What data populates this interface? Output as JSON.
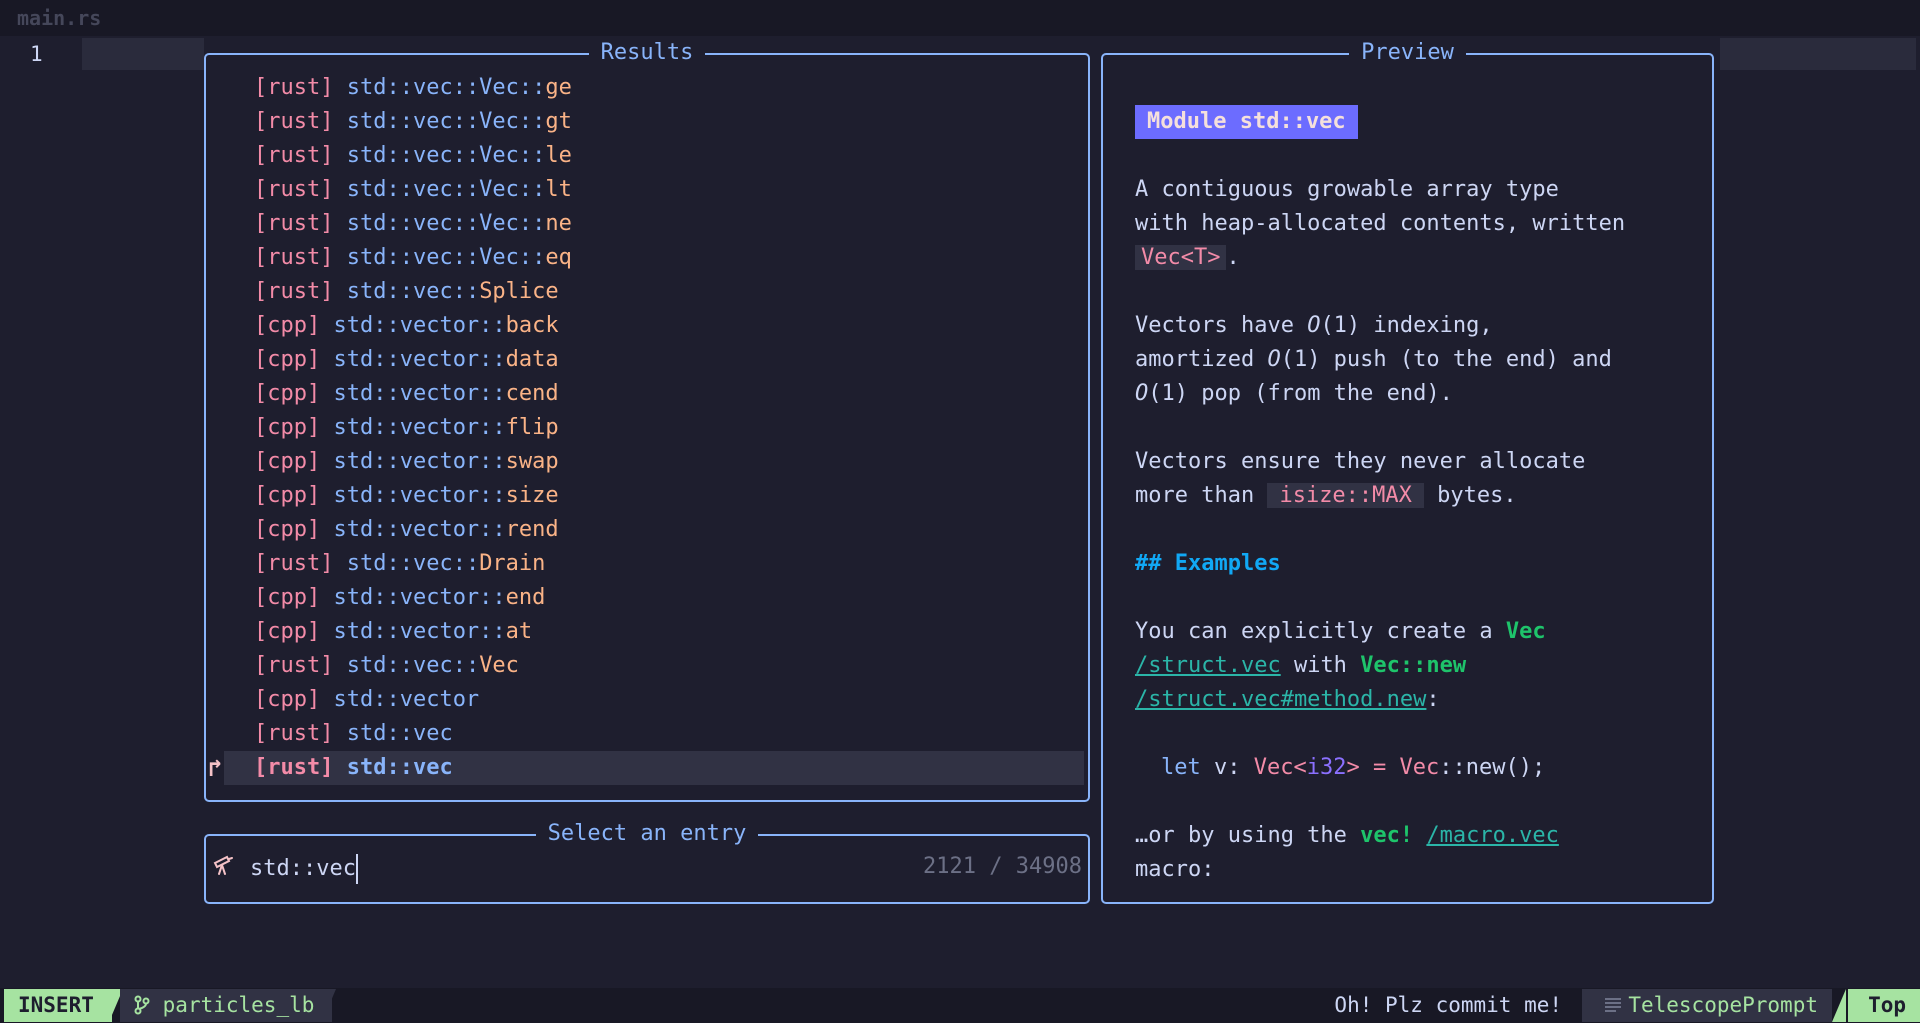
{
  "tabline": {
    "filename": "main.rs"
  },
  "editor": {
    "line_number": "1"
  },
  "results": {
    "title": "Results",
    "items": [
      {
        "tag": "[rust]",
        "path": "std::vec::Vec::",
        "member": "ge"
      },
      {
        "tag": "[rust]",
        "path": "std::vec::Vec::",
        "member": "gt"
      },
      {
        "tag": "[rust]",
        "path": "std::vec::Vec::",
        "member": "le"
      },
      {
        "tag": "[rust]",
        "path": "std::vec::Vec::",
        "member": "lt"
      },
      {
        "tag": "[rust]",
        "path": "std::vec::Vec::",
        "member": "ne"
      },
      {
        "tag": "[rust]",
        "path": "std::vec::Vec::",
        "member": "eq"
      },
      {
        "tag": "[rust]",
        "path": "std::vec::",
        "member": "Splice"
      },
      {
        "tag": "[cpp]",
        "path": "std::vector::",
        "member": "back"
      },
      {
        "tag": "[cpp]",
        "path": "std::vector::",
        "member": "data"
      },
      {
        "tag": "[cpp]",
        "path": "std::vector::",
        "member": "cend"
      },
      {
        "tag": "[cpp]",
        "path": "std::vector::",
        "member": "flip"
      },
      {
        "tag": "[cpp]",
        "path": "std::vector::",
        "member": "swap"
      },
      {
        "tag": "[cpp]",
        "path": "std::vector::",
        "member": "size"
      },
      {
        "tag": "[cpp]",
        "path": "std::vector::",
        "member": "rend"
      },
      {
        "tag": "[rust]",
        "path": "std::vec::",
        "member": "Drain"
      },
      {
        "tag": "[cpp]",
        "path": "std::vector::",
        "member": "end"
      },
      {
        "tag": "[cpp]",
        "path": "std::vector::",
        "member": "at"
      },
      {
        "tag": "[rust]",
        "path": "std::vec::",
        "member": "Vec"
      },
      {
        "tag": "[cpp]",
        "path": "std::vector",
        "member": ""
      },
      {
        "tag": "[rust]",
        "path": "std::vec",
        "member": ""
      },
      {
        "tag": "[rust]",
        "path": "std::vec",
        "member": "",
        "selected": true
      }
    ],
    "selection_caret": "↱"
  },
  "prompt": {
    "title": "Select an entry",
    "icon": "telescope-icon",
    "value": "std::vec",
    "count": "2121 / 34908"
  },
  "preview": {
    "title": "Preview",
    "heading": "Module std::vec",
    "p1_line1": "A contiguous growable array type",
    "p1_line2": "with heap-allocated contents, written",
    "p1_code": "Vec<T>",
    "p1_end": ".",
    "p2_a": "Vectors have ",
    "p2_o": "O",
    "p2_b": "(1) indexing,",
    "p2_c": "amortized ",
    "p2_d": "(1) push (to the end) and",
    "p2_e": "(1) pop (from the end).",
    "p3_line1": "Vectors ensure they never allocate",
    "p3_a": "more than ",
    "p3_code": "isize::MAX",
    "p3_b": " bytes.",
    "h2": "## Examples",
    "p4_a": "You can explicitly create a ",
    "p4_vec": "Vec",
    "p4_link1": "/struct.vec",
    "p4_with": " with ",
    "p4_new": "Vec::new",
    "p4_link2": "/struct.vec#method.new",
    "p4_colon": ":",
    "code_let": "let",
    "code_v": " v: ",
    "code_vec": "Vec",
    "code_lt": "<",
    "code_i32": "i32",
    "code_gt": ">",
    "code_eq": " = ",
    "code_vec2": "Vec",
    "code_rest": "::new();",
    "p5_a": "…or by using the ",
    "p5_vec": "vec!",
    "p5_link": "/macro.vec",
    "p5_macro": "macro:"
  },
  "statusline": {
    "mode": "INSERT",
    "branch_icon": "git-branch-icon",
    "branch": "particles_lb",
    "message": "Oh! Plz commit me!",
    "filetype_icon": "lines-icon",
    "filetype": "TelescopePrompt",
    "position": "Top"
  },
  "colors": {
    "background": "#1e1e2e",
    "border": "#89b4fa",
    "accent_green": "#a6e3a1",
    "tag": "#f38ba8",
    "path": "#89b4fa",
    "member": "#fab387"
  }
}
